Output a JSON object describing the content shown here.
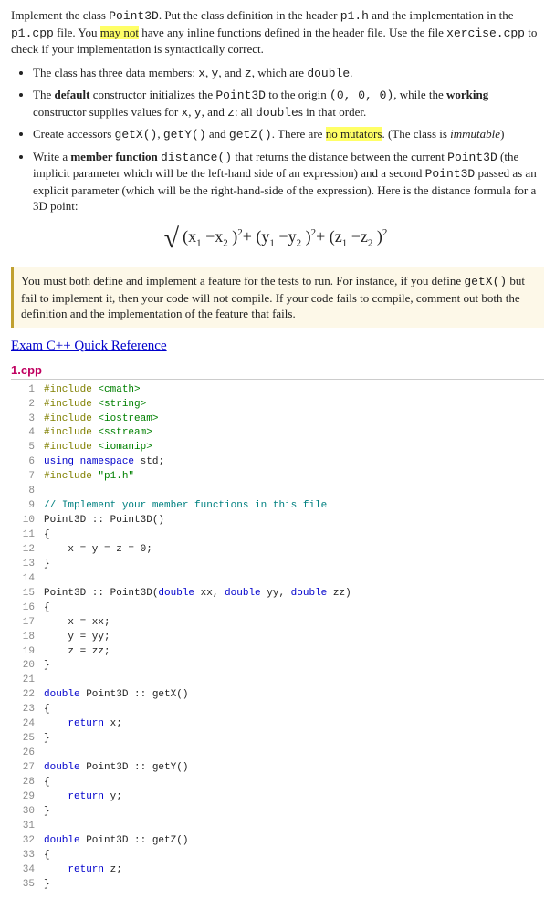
{
  "intro": {
    "pre1": "Implement the class ",
    "cls": "Point3D",
    "mid1": ". Put the class definition in the header ",
    "hdr": "p1.h",
    "mid2": " and the implementation in the ",
    "src": "p1.cpp",
    "mid3": " file. You ",
    "hl1": "may not",
    "mid4": " have any inline functions defined in the header file. Use the file ",
    "xfile": "xercise.cpp",
    "post": " to check if your implementation is syntactically correct."
  },
  "bullets": {
    "b1": {
      "pre": "The class has three data members: ",
      "m1": "x",
      "c1": ", ",
      "m2": "y",
      "c2": ", and ",
      "m3": "z",
      "post": ", which are ",
      "t": "double",
      "end": "."
    },
    "b2": {
      "pre": "The ",
      "bold1": "default",
      "mid1": " constructor initializes the ",
      "cls": "Point3D",
      "mid2": " to the origin ",
      "orig": "(0, 0, 0)",
      "mid3": ", while the ",
      "bold2": "working",
      "mid4": " constructor supplies values for ",
      "m1": "x",
      "c1": ", ",
      "m2": "y",
      "c2": ", and ",
      "m3": "z",
      "mid5": ": all ",
      "t": "double",
      "post": "s in that order."
    },
    "b3": {
      "pre": "Create accessors ",
      "f1": "getX()",
      "c1": ", ",
      "f2": "getY()",
      "c2": " and ",
      "f3": "getZ()",
      "mid": ". There are ",
      "hl": "no mutators",
      "post": ". (The class is ",
      "it": "immutable",
      "end": ")"
    },
    "b4": {
      "pre": "Write a ",
      "bold": "member function",
      "sp": " ",
      "fn": "distance()",
      "mid1": " that returns the distance between the current ",
      "cls1": "Point3D",
      "mid2": " (the implicit parameter which will be the left-hand side of an expression) and a second ",
      "cls2": "Point3D",
      "post": " passed as an explicit parameter (which will be the right-hand-side of the expression). Here is the distance formula for a 3D point:"
    }
  },
  "formula": {
    "x1": "x",
    "s1": "1",
    "x2": "x",
    "s2": "2",
    "y1": "y",
    "s3": "1",
    "y2": "y",
    "s4": "2",
    "z1": "z",
    "s5": "1",
    "z2": "z",
    "s6": "2",
    "exp": "2"
  },
  "note": {
    "pre": "You must both define and implement a feature for the tests to run. For instance, if you define ",
    "fn": "getX()",
    "post": " but fail to implement it, then your code will not compile. If your code fails to compile, comment out both the definition and the implementation of the feature that fails."
  },
  "ref_link": "Exam C++ Quick Reference",
  "filename": "1.cpp",
  "code": [
    {
      "n": "1",
      "h": "<span class='c-pp'>#include</span> <span class='c-inc'>&lt;cmath&gt;</span>"
    },
    {
      "n": "2",
      "h": "<span class='c-pp'>#include</span> <span class='c-inc'>&lt;string&gt;</span>"
    },
    {
      "n": "3",
      "h": "<span class='c-pp'>#include</span> <span class='c-inc'>&lt;iostream&gt;</span>"
    },
    {
      "n": "4",
      "h": "<span class='c-pp'>#include</span> <span class='c-inc'>&lt;sstream&gt;</span>"
    },
    {
      "n": "5",
      "h": "<span class='c-pp'>#include</span> <span class='c-inc'>&lt;iomanip&gt;</span>"
    },
    {
      "n": "6",
      "h": "<span class='c-kw'>using</span> <span class='c-kw'>namespace</span> std;"
    },
    {
      "n": "7",
      "h": "<span class='c-pp'>#include</span> <span class='c-inc'>\"p1.h\"</span>"
    },
    {
      "n": "8",
      "h": ""
    },
    {
      "n": "9",
      "h": "<span class='c-cmt'>// Implement your member functions in this file</span>"
    },
    {
      "n": "10",
      "h": "Point3D :: Point3D()"
    },
    {
      "n": "11",
      "h": "{"
    },
    {
      "n": "12",
      "h": "    x = y = z = 0;"
    },
    {
      "n": "13",
      "h": "}"
    },
    {
      "n": "14",
      "h": ""
    },
    {
      "n": "15",
      "h": "Point3D :: Point3D(<span class='c-kw'>double</span> xx, <span class='c-kw'>double</span> yy, <span class='c-kw'>double</span> zz)"
    },
    {
      "n": "16",
      "h": "{"
    },
    {
      "n": "17",
      "h": "    x = xx;"
    },
    {
      "n": "18",
      "h": "    y = yy;"
    },
    {
      "n": "19",
      "h": "    z = zz;"
    },
    {
      "n": "20",
      "h": "}"
    },
    {
      "n": "21",
      "h": ""
    },
    {
      "n": "22",
      "h": "<span class='c-kw'>double</span> Point3D :: getX()"
    },
    {
      "n": "23",
      "h": "{"
    },
    {
      "n": "24",
      "h": "    <span class='c-kw'>return</span> x;"
    },
    {
      "n": "25",
      "h": "}"
    },
    {
      "n": "26",
      "h": ""
    },
    {
      "n": "27",
      "h": "<span class='c-kw'>double</span> Point3D :: getY()"
    },
    {
      "n": "28",
      "h": "{"
    },
    {
      "n": "29",
      "h": "    <span class='c-kw'>return</span> y;"
    },
    {
      "n": "30",
      "h": "}"
    },
    {
      "n": "31",
      "h": ""
    },
    {
      "n": "32",
      "h": "<span class='c-kw'>double</span> Point3D :: getZ()"
    },
    {
      "n": "33",
      "h": "{"
    },
    {
      "n": "34",
      "h": "    <span class='c-kw'>return</span> z;"
    },
    {
      "n": "35",
      "h": "}"
    }
  ]
}
